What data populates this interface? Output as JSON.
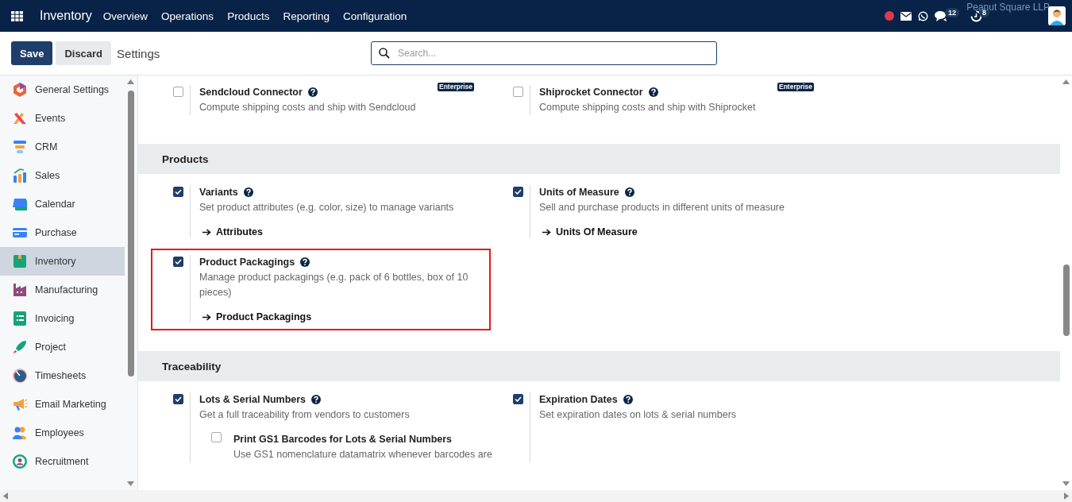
{
  "navbar": {
    "app_name": "Inventory",
    "menu": [
      "Overview",
      "Operations",
      "Products",
      "Reporting",
      "Configuration"
    ],
    "company": "Peanut Square LLP",
    "messages_count": "12",
    "activities_count": "8"
  },
  "toolbar": {
    "save": "Save",
    "discard": "Discard",
    "breadcrumb": "Settings",
    "search": {
      "placeholder": "Search..."
    }
  },
  "sidebar": {
    "items": [
      {
        "label": "General Settings",
        "selected": false
      },
      {
        "label": "Events",
        "selected": false
      },
      {
        "label": "CRM",
        "selected": false
      },
      {
        "label": "Sales",
        "selected": false
      },
      {
        "label": "Calendar",
        "selected": false
      },
      {
        "label": "Purchase",
        "selected": false
      },
      {
        "label": "Inventory",
        "selected": true
      },
      {
        "label": "Manufacturing",
        "selected": false
      },
      {
        "label": "Invoicing",
        "selected": false
      },
      {
        "label": "Project",
        "selected": false
      },
      {
        "label": "Timesheets",
        "selected": false
      },
      {
        "label": "Email Marketing",
        "selected": false
      },
      {
        "label": "Employees",
        "selected": false
      },
      {
        "label": "Recruitment",
        "selected": false
      }
    ]
  },
  "sections": [
    {
      "settings": [
        {
          "title": "Sendcloud Connector",
          "description": "Compute shipping costs and ship with Sendcloud",
          "checked": false,
          "badge": "Enterprise",
          "highlighted": false
        },
        {
          "title": "Shiprocket Connector",
          "description": "Compute shipping costs and ship with Shiprocket",
          "checked": false,
          "badge": "Enterprise",
          "highlighted": false
        }
      ]
    },
    {
      "title": "Products",
      "settings": [
        {
          "title": "Variants",
          "description": "Set product attributes (e.g. color, size) to manage variants",
          "checked": true,
          "link": "Attributes",
          "highlighted": false
        },
        {
          "title": "Units of Measure",
          "description": "Sell and purchase products in different units of measure",
          "checked": true,
          "link": "Units Of Measure",
          "highlighted": false
        },
        {
          "title": "Product Packagings",
          "description": "Manage product packagings (e.g. pack of 6 bottles, box of 10 pieces)",
          "checked": true,
          "link": "Product Packagings",
          "highlighted": true
        }
      ]
    },
    {
      "title": "Traceability",
      "settings": [
        {
          "title": "Lots & Serial Numbers",
          "description": "Get a full traceability from vendors to customers",
          "checked": true,
          "highlighted": false,
          "sub": [
            {
              "title": "Print GS1 Barcodes for Lots & Serial Numbers",
              "description": "Use GS1 nomenclature datamatrix whenever barcodes are",
              "checked": false
            }
          ]
        },
        {
          "title": "Expiration Dates",
          "description": "Set expiration dates on lots & serial numbers",
          "checked": true,
          "highlighted": false
        }
      ]
    }
  ]
}
